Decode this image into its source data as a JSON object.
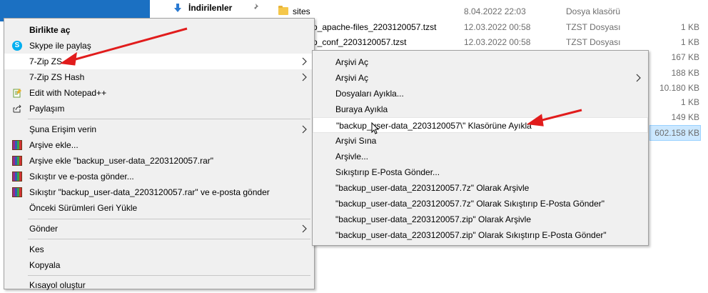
{
  "explorer": {
    "quick_access_item": "İndirilenler",
    "files": [
      {
        "name": "sites",
        "date": "8.04.2022 22:03",
        "type": "Dosya klasörü",
        "size": ""
      },
      {
        "name": "p_apache-files_2203120057.tzst",
        "date": "12.03.2022 00:58",
        "type": "TZST Dosyası",
        "size": "1 KB"
      },
      {
        "name": "p_conf_2203120057.tzst",
        "date": "12.03.2022 00:58",
        "type": "TZST Dosyası",
        "size": "1 KB"
      }
    ],
    "extra_sizes": [
      "167 KB",
      "188 KB",
      "10.180 KB",
      "1 KB",
      "149 KB",
      "602.158 KB"
    ]
  },
  "context_menu": {
    "items": [
      {
        "label": "Birlikte aç",
        "bold": true
      },
      {
        "label": "Skype ile paylaş"
      },
      {
        "label": "7-Zip ZS"
      },
      {
        "label": "7-Zip ZS Hash"
      },
      {
        "label": "Edit with Notepad++"
      },
      {
        "label": "Paylaşım"
      },
      {
        "label": "Şuna Erişim verin"
      },
      {
        "label": "Arşive ekle..."
      },
      {
        "label": "Arşive ekle \"backup_user-data_2203120057.rar\""
      },
      {
        "label": "Sıkıştır ve e-posta gönder..."
      },
      {
        "label": "Sıkıştır \"backup_user-data_2203120057.rar\" ve e-posta gönder"
      },
      {
        "label": "Önceki Sürümleri Geri Yükle"
      },
      {
        "label": "Gönder"
      },
      {
        "label": "Kes"
      },
      {
        "label": "Kopyala"
      },
      {
        "label": "Kısayol oluştur"
      }
    ]
  },
  "submenu": {
    "items": [
      {
        "label": "Arşivi Aç"
      },
      {
        "label": "Arşivi Aç"
      },
      {
        "label": "Dosyaları Ayıkla..."
      },
      {
        "label": "Buraya Ayıkla"
      },
      {
        "label": "\"backup_user-data_2203120057\\\" Klasörüne Ayıkla"
      },
      {
        "label": "Arşivi Sına"
      },
      {
        "label": "Arşivle..."
      },
      {
        "label": "Sıkıştırıp E-Posta Gönder..."
      },
      {
        "label": "\"backup_user-data_2203120057.7z\" Olarak Arşivle"
      },
      {
        "label": "\"backup_user-data_2203120057.7z\" Olarak Sıkıştırıp E-Posta Gönder\""
      },
      {
        "label": "\"backup_user-data_2203120057.zip\" Olarak Arşivle"
      },
      {
        "label": "\"backup_user-data_2203120057.zip\" Olarak Sıkıştırıp E-Posta Gönder\""
      }
    ]
  },
  "colors": {
    "menu_bg": "#f0f0f0",
    "highlight": "#ffffff",
    "annotation_arrow": "#e11c1c",
    "selection": "#cce8ff"
  }
}
